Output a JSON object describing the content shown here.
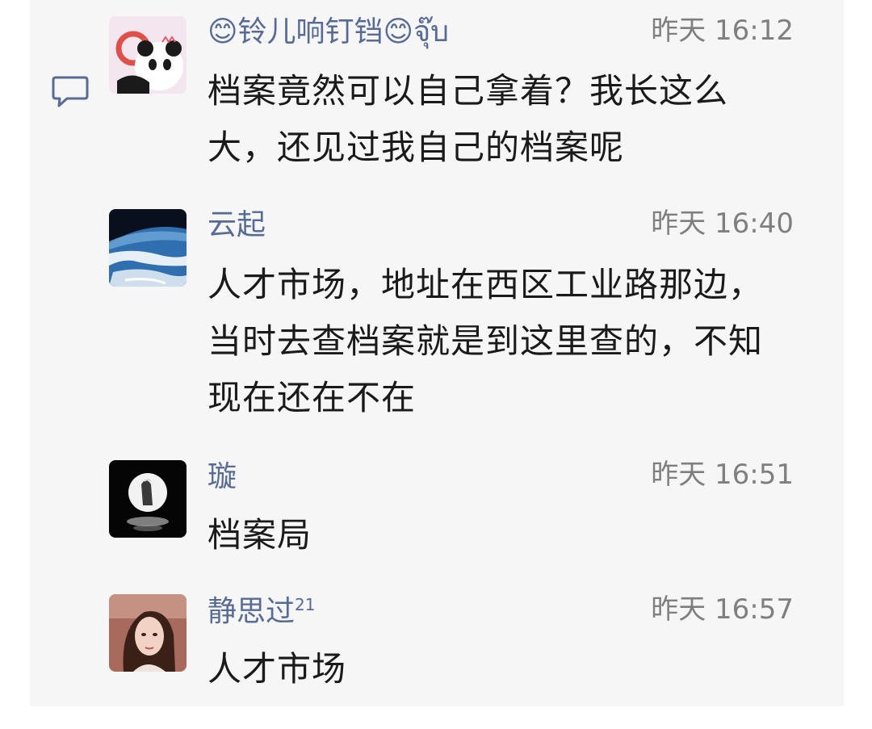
{
  "comments": [
    {
      "user_name": "铃儿响钉铛",
      "name_prefix_emoji": "😊",
      "name_suffix_emoji": "😊",
      "name_suffix_text": "จุ๊บ",
      "time": "昨天 16:12",
      "content": "档案竟然可以自己拿着？我长这么大，还见过我自己的档案呢",
      "avatar_icon": "panda-avatar-icon"
    },
    {
      "user_name": "云起",
      "time": "昨天 16:40",
      "content": "人才市场，地址在西区工业路那边，当时去查档案就是到这里查的，不知现在还在不在",
      "avatar_icon": "earth-avatar-icon"
    },
    {
      "user_name": "璇",
      "time": "昨天 16:51",
      "content": "档案局",
      "avatar_icon": "moon-avatar-icon"
    },
    {
      "user_name": "静思过",
      "name_superscript": "21",
      "time": "昨天 16:57",
      "content": "人才市场",
      "avatar_icon": "portrait-avatar-icon"
    }
  ],
  "icons": {
    "reply": "comment-bubble-icon"
  },
  "colors": {
    "name": "#576b95",
    "time": "#7f7f7f",
    "text": "#1a1a1a",
    "panel_background": "#f6f6f6"
  }
}
